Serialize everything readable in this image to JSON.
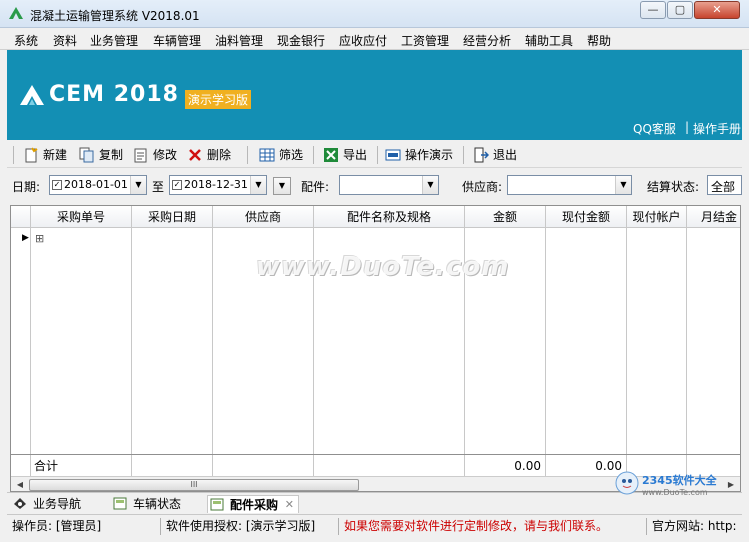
{
  "window": {
    "title": "混凝土运输管理系统 V2018.01",
    "min_label": "—",
    "max_label": "▢",
    "close_label": "✕"
  },
  "menu": [
    "系统",
    "资料",
    "业务管理",
    "车辆管理",
    "油料管理",
    "现金银行",
    "应收应付",
    "工资管理",
    "经营分析",
    "辅助工具",
    "帮助"
  ],
  "banner": {
    "logo_text": "CEM 2018",
    "edition": "演示学习版",
    "qq_service": "QQ客服",
    "separator": "|",
    "manual": "操作手册",
    "bg_color": "#138fb4"
  },
  "toolbar": {
    "new": "新建",
    "copy": "复制",
    "edit": "修改",
    "delete": "删除",
    "filter": "筛选",
    "export": "导出",
    "demo": "操作演示",
    "exit": "退出"
  },
  "filter": {
    "date_label": "日期:",
    "date_from": "2018-01-01",
    "to_label": "至",
    "date_to": "2018-12-31",
    "part_label": "配件:",
    "part_value": "",
    "supplier_label": "供应商:",
    "supplier_value": "",
    "status_label": "结算状态:",
    "status_value": "全部"
  },
  "grid": {
    "columns": [
      "采购单号",
      "采购日期",
      "供应商",
      "配件名称及规格",
      "金额",
      "现付金额",
      "现付帐户",
      "月结金"
    ],
    "expand_glyph": "⊞",
    "row_indicator": "▶",
    "footer": {
      "label": "合计",
      "amount": "0.00",
      "paid_amount": "0.00"
    },
    "scroll_grip": "III"
  },
  "watermark": "www.DuoTe.com",
  "tabs": [
    {
      "label": "业务导航",
      "active": false
    },
    {
      "label": "车辆状态",
      "active": false
    },
    {
      "label": "配件采购",
      "active": true
    }
  ],
  "tab_close": "✕",
  "statusbar": {
    "operator": "操作员: [管理员]",
    "license": "软件使用授权: [演示学习版]",
    "notice": "如果您需要对软件进行定制修改，请与我们联系。",
    "website": "官方网站: http:"
  },
  "corner_logo": {
    "text": "2345软件大全",
    "url": "www.DuoTe.com"
  }
}
